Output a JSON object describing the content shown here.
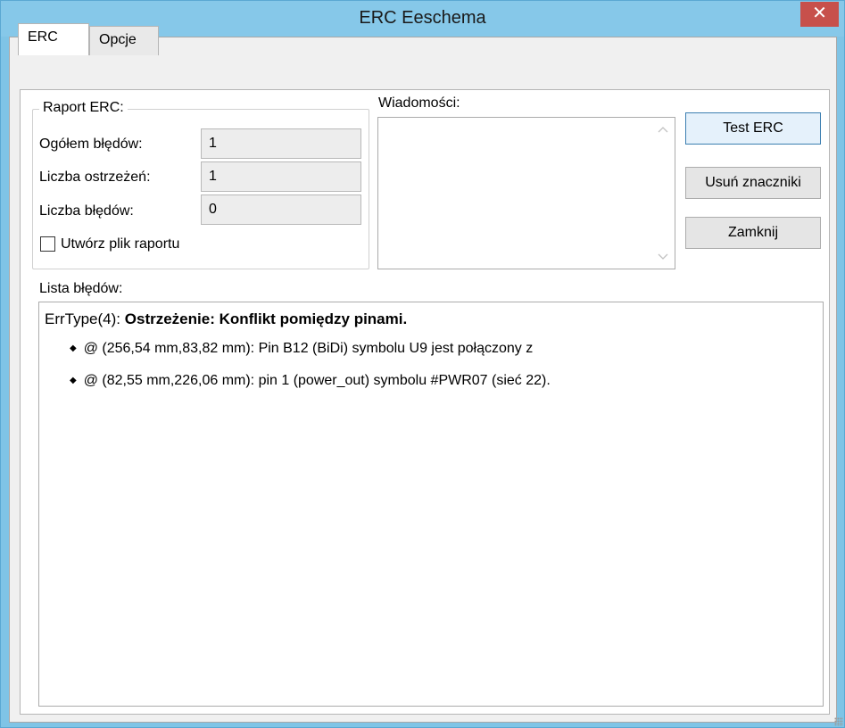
{
  "window": {
    "title": "ERC Eeschema",
    "close_glyph": "✕"
  },
  "tabs": [
    {
      "label": "ERC"
    },
    {
      "label": "Opcje"
    }
  ],
  "report": {
    "title": "Raport ERC:",
    "rows": [
      {
        "label": "Ogółem błędów:",
        "value": "1"
      },
      {
        "label": "Liczba ostrzeżeń:",
        "value": "1"
      },
      {
        "label": "Liczba błędów:",
        "value": "0"
      }
    ],
    "checkbox_label": "Utwórz plik raportu",
    "checkbox_checked": false
  },
  "messages": {
    "label": "Wiadomości:",
    "content": ""
  },
  "buttons": {
    "test": "Test ERC",
    "remove": "Usuń znaczniki",
    "close": "Zamknij"
  },
  "error_list": {
    "label": "Lista błędów:",
    "entries": [
      {
        "type": "ErrType(4):",
        "title": "Ostrzeżenie: Konflikt pomiędzy pinami.",
        "items": [
          "@ (256,54 mm,83,82 mm): Pin B12 (BiDi) symbolu U9 jest  połączony z",
          "@ (82,55 mm,226,06 mm): pin 1 (power_out) symbolu #PWR07 (sieć 22)."
        ]
      }
    ]
  },
  "icons": {
    "close": "close-icon",
    "scroll_up": "chevron-up-icon",
    "scroll_down": "chevron-down-icon",
    "bullet": "diamond-bullet-icon",
    "resize": "resize-grip-icon"
  },
  "colors": {
    "titlebar": "#86c8e9",
    "close_button": "#c7504b",
    "default_button_border": "#3c7fb1"
  }
}
